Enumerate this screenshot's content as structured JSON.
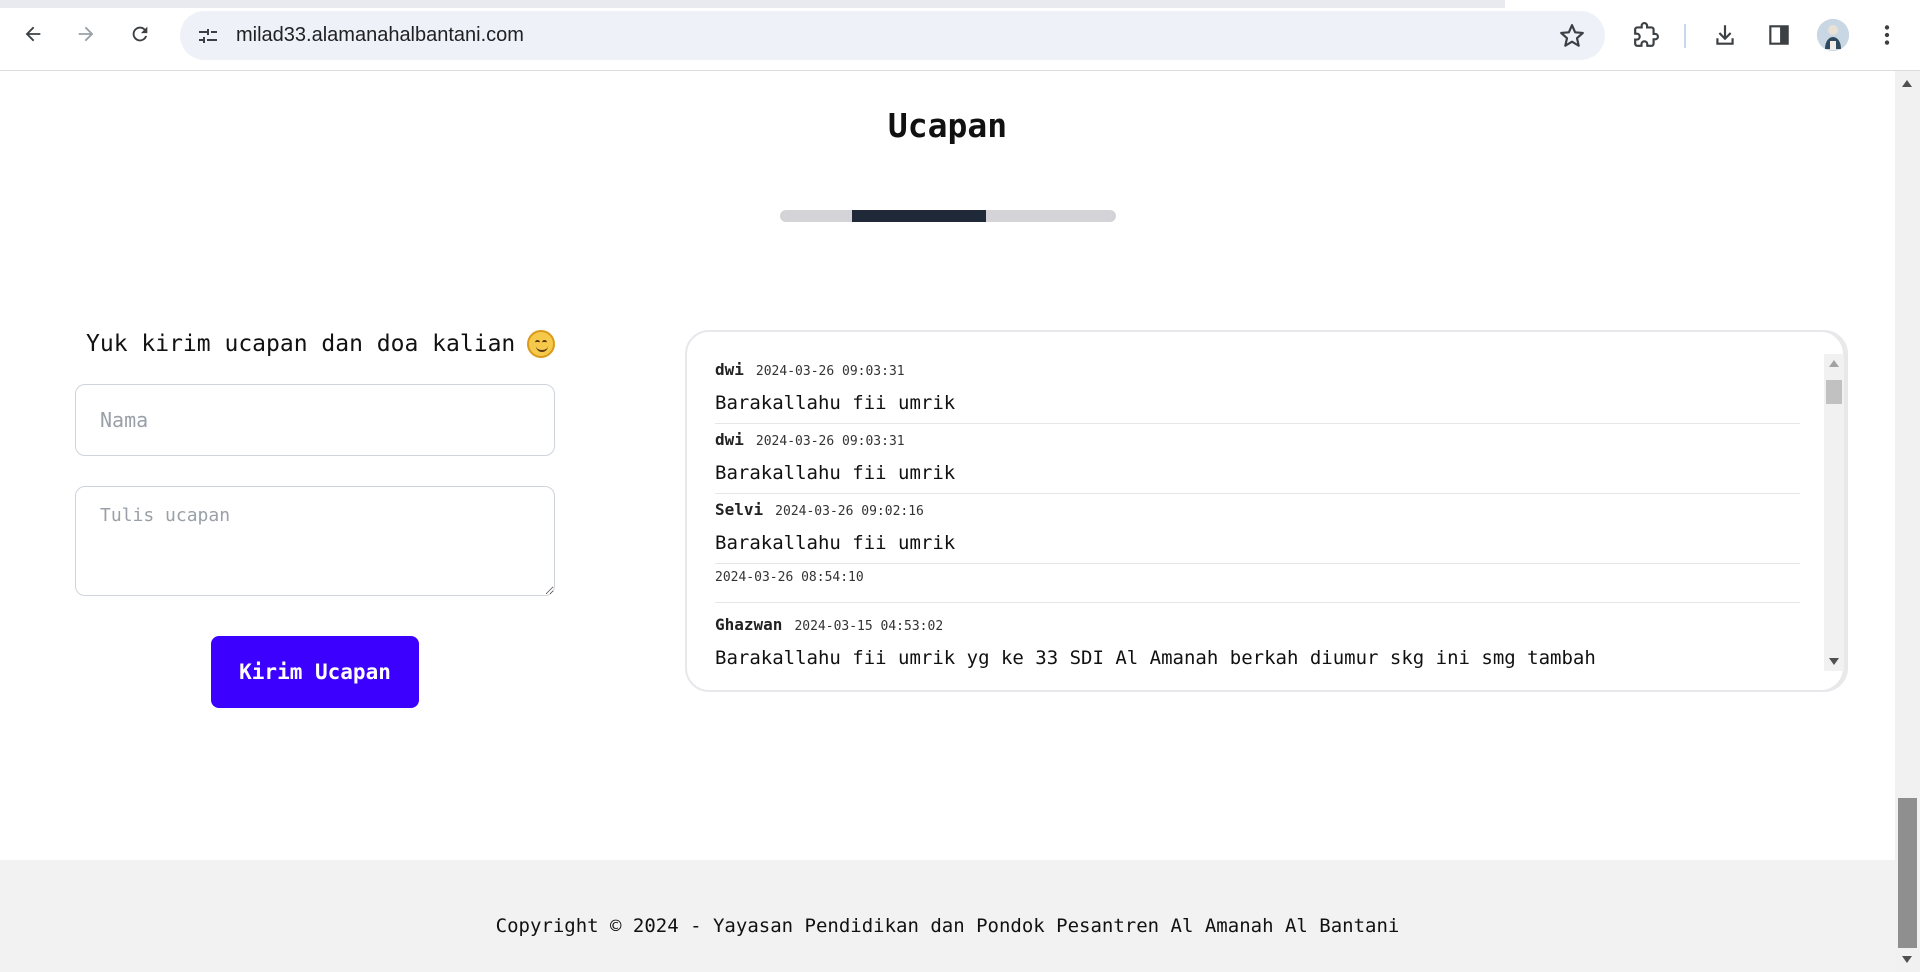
{
  "browser": {
    "url": "milad33.alamanahalbantani.com"
  },
  "section": {
    "title": "Ucapan"
  },
  "form": {
    "title": "Yuk kirim ucapan dan doa kalian",
    "name_placeholder": "Nama",
    "message_placeholder": "Tulis ucapan",
    "submit_label": "Kirim Ucapan"
  },
  "comments": [
    {
      "name": "dwi",
      "time": "2024-03-26 09:03:31",
      "message": "Barakallahu fii umrik"
    },
    {
      "name": "dwi",
      "time": "2024-03-26 09:03:31",
      "message": "Barakallahu fii umrik"
    },
    {
      "name": "Selvi",
      "time": "2024-03-26 09:02:16",
      "message": "Barakallahu fii umrik"
    },
    {
      "name": "",
      "time": "2024-03-26 08:54:10",
      "message": ""
    },
    {
      "name": "Ghazwan",
      "time": "2024-03-15 04:53:02",
      "message": "Barakallahu fii umrik yg ke 33 SDI Al Amanah berkah diumur skg ini smg tambah"
    }
  ],
  "footer": {
    "copyright": "Copyright © 2024 - Yayasan Pendidikan dan Pondok Pesantren Al Amanah Al Bantani"
  },
  "icons": {
    "back": "arrow-left-icon",
    "forward": "arrow-right-icon",
    "reload": "reload-icon",
    "site_info": "tune-icon",
    "bookmark": "star-icon",
    "extensions": "puzzle-icon",
    "downloads": "download-icon",
    "side_panel": "side-panel-icon",
    "menu": "kebab-menu-icon",
    "emoji": "hugging-face-emoji"
  },
  "colors": {
    "accent": "#3c00ff",
    "divider_dark": "#1f2937",
    "footer_bg": "#f2f2f2"
  }
}
